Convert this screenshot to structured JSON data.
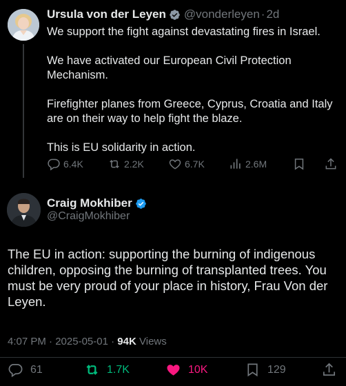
{
  "parent_tweet": {
    "author_name": "Ursula von der Leyen",
    "handle": "@vonderleyen",
    "separator": "·",
    "age": "2d",
    "paragraphs": [
      "We support the fight against devastating fires in Israel.",
      "We have activated our European Civil Protection Mechanism.",
      "Firefighter planes from Greece, Cyprus, Croatia and Italy are on their way to help fight the blaze.",
      "This is EU solidarity in action."
    ],
    "replies": "6.4K",
    "reposts": "2.2K",
    "likes": "6.7K",
    "views": "2.6M",
    "avatar_icon": "person-avatar"
  },
  "reply_tweet": {
    "author_name": "Craig Mokhiber",
    "handle": "@CraigMokhiber",
    "text": "The EU in action: supporting the burning of indigenous children, opposing the burning of transplanted trees. You must be very proud of your place in history, Frau Von der Leyen.",
    "time": "4:07 PM",
    "separator": "·",
    "date": "2025-05-01",
    "separator2": "·",
    "views_count": "94K",
    "views_label": "Views",
    "replies": "61",
    "reposts": "1.7K",
    "likes": "10K",
    "bookmarks": "129",
    "avatar_icon": "person-avatar"
  },
  "colors": {
    "background": "#000000",
    "text": "#e7e9ea",
    "muted": "#71767b",
    "verified": "#1d9bf0",
    "repost_active": "#00ba7c",
    "like_active": "#f91880"
  }
}
